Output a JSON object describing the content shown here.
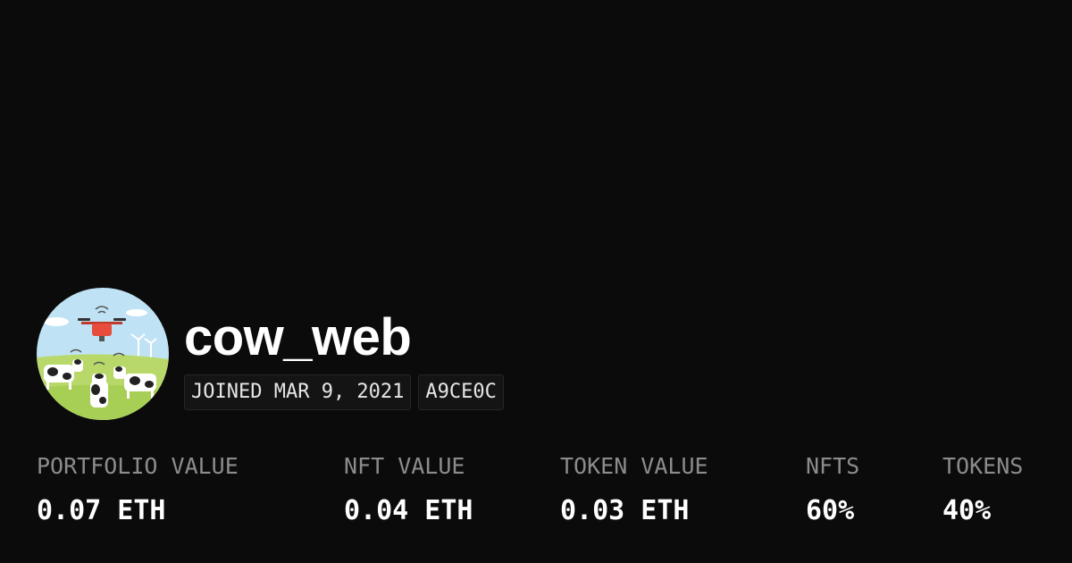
{
  "profile": {
    "username": "cow_web",
    "joined": "JOINED MAR 9, 2021",
    "address": "A9CE0C",
    "avatar_icon": "farm-drone-cows-avatar"
  },
  "stats": [
    {
      "label": "PORTFOLIO VALUE",
      "value": "0.07 ETH"
    },
    {
      "label": "NFT VALUE",
      "value": "0.04 ETH"
    },
    {
      "label": "TOKEN VALUE",
      "value": "0.03 ETH"
    },
    {
      "label": "NFTS",
      "value": "60%"
    },
    {
      "label": "TOKENS",
      "value": "40%"
    }
  ],
  "colors": {
    "background": "#0b0b0b",
    "text": "#ffffff",
    "muted_text": "#8c8c8c",
    "badge_background": "#141414"
  }
}
